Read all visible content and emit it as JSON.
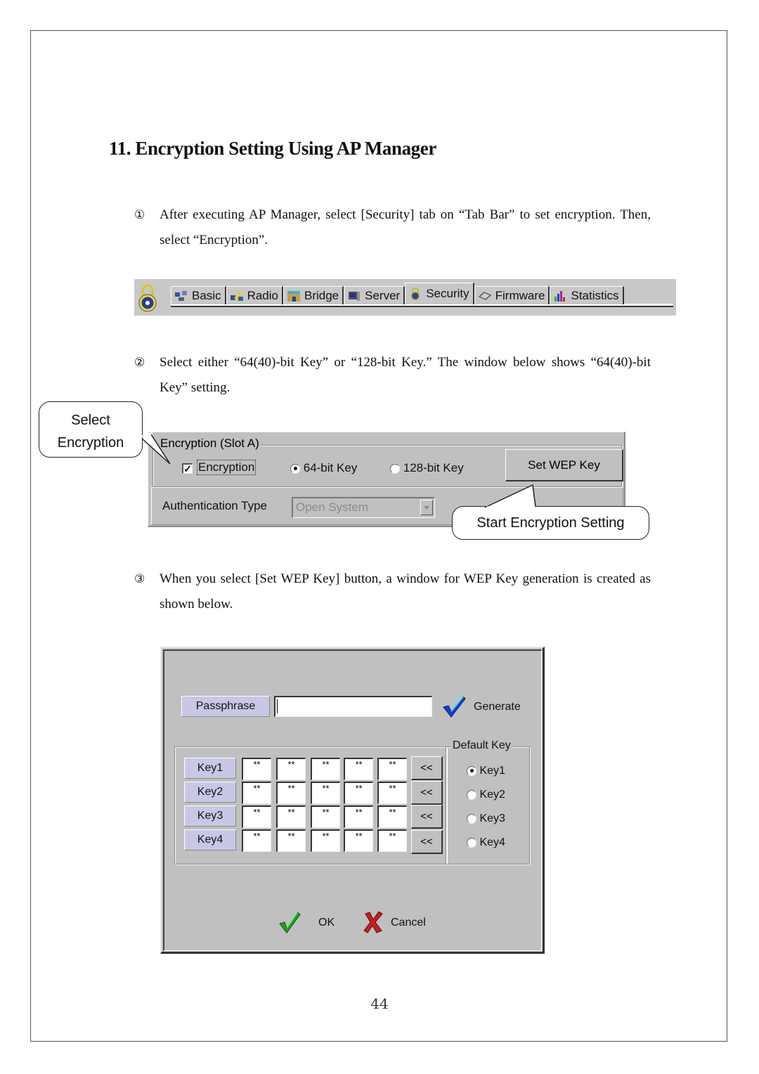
{
  "page": {
    "title": "11. Encryption Setting Using AP Manager",
    "page_number": "44"
  },
  "steps": [
    {
      "marker": "①",
      "text": "After executing AP Manager, select [Security] tab on “Tab Bar” to set encryption. Then, select “Encryption”."
    },
    {
      "marker": "②",
      "text": "Select either “64(40)-bit Key” or “128-bit Key.” The window below shows “64(40)-bit Key” setting."
    },
    {
      "marker": "③",
      "text": "When you select [Set WEP Key] button, a window for WEP Key generation is created as shown below."
    }
  ],
  "tab_bar": {
    "logo_icon": "padlock-icon",
    "tabs": [
      {
        "label": "Basic",
        "icon": "network-computers-icon",
        "active": false
      },
      {
        "label": "Radio",
        "icon": "radio-antenna-icon",
        "active": false
      },
      {
        "label": "Bridge",
        "icon": "bridge-icon",
        "active": false
      },
      {
        "label": "Server",
        "icon": "server-monitor-icon",
        "active": false
      },
      {
        "label": "Security",
        "icon": "padlock-icon",
        "active": true
      },
      {
        "label": "Firmware",
        "icon": "chip-icon",
        "active": false
      },
      {
        "label": "Statistics",
        "icon": "bar-chart-icon",
        "active": false
      }
    ]
  },
  "encryption_panel": {
    "group_label": "Encryption (Slot A)",
    "encryption_checkbox": {
      "label": "Encryption",
      "checked": true
    },
    "key_options": [
      {
        "label": "64-bit Key",
        "selected": true
      },
      {
        "label": "128-bit Key",
        "selected": false
      }
    ],
    "set_wep_key_button": "Set WEP Key",
    "auth_type_label": "Authentication Type",
    "auth_type_value": "Open System"
  },
  "callouts": {
    "select_encryption_line1": "Select",
    "select_encryption_line2": "Encryption",
    "start_encryption": "Start Encryption Setting"
  },
  "wep_dialog": {
    "passphrase_label": "Passphrase",
    "passphrase_value": "",
    "generate_label": "Generate",
    "default_key_label": "Default Key",
    "keys": [
      {
        "label": "Key1",
        "values": [
          "**",
          "**",
          "**",
          "**",
          "**"
        ],
        "copy_button": "<<",
        "radio_label": "Key1",
        "default": true
      },
      {
        "label": "Key2",
        "values": [
          "**",
          "**",
          "**",
          "**",
          "**"
        ],
        "copy_button": "<<",
        "radio_label": "Key2",
        "default": false
      },
      {
        "label": "Key3",
        "values": [
          "**",
          "**",
          "**",
          "**",
          "**"
        ],
        "copy_button": "<<",
        "radio_label": "Key3",
        "default": false
      },
      {
        "label": "Key4",
        "values": [
          "**",
          "**",
          "**",
          "**",
          "**"
        ],
        "copy_button": "<<",
        "radio_label": "Key4",
        "default": false
      }
    ],
    "ok_label": "OK",
    "cancel_label": "Cancel"
  },
  "colors": {
    "ui_gray": "#c0c0c0",
    "label_lavender": "#c8c8e6",
    "generate_check_blue": "#1e3cc8",
    "ok_check_green": "#28a028",
    "cancel_x_red": "#c81e1e"
  }
}
